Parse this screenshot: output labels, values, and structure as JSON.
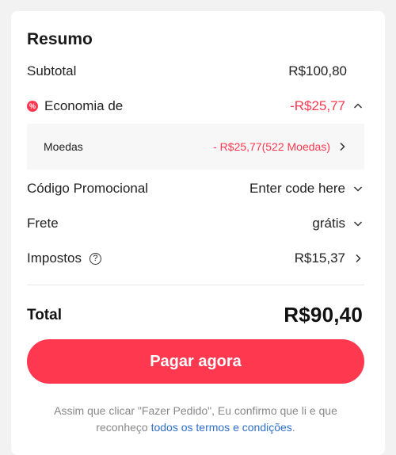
{
  "summary": {
    "title": "Resumo",
    "subtotal": {
      "label": "Subtotal",
      "value": "R$100,80"
    },
    "savings": {
      "badge": "%",
      "label": "Economia de",
      "value": "-R$25,77",
      "expanded": true,
      "coins": {
        "label": "Moedas",
        "value": "- R$25,77(522 Moedas)"
      }
    },
    "promo": {
      "label": "Código Promocional",
      "placeholder": "Enter code here"
    },
    "shipping": {
      "label": "Frete",
      "value": "grátis"
    },
    "taxes": {
      "label": "Impostos",
      "help": "?",
      "value": "R$15,37"
    },
    "total": {
      "label": "Total",
      "value": "R$90,40"
    },
    "pay_button": "Pagar agora",
    "disclaimer": {
      "text_line1": "Assim que clicar \"Fazer Pedido\", Eu confirmo que li e que",
      "text_line2": "reconheço ",
      "link": "todos os termos e condições",
      "suffix": "."
    }
  },
  "colors": {
    "accent": "#fd384f",
    "link": "#2e6fcb",
    "muted": "#888888"
  },
  "icons": [
    "discount-badge-icon",
    "chevron-up-icon",
    "chevron-right-icon",
    "chevron-down-icon",
    "help-circle-icon"
  ]
}
